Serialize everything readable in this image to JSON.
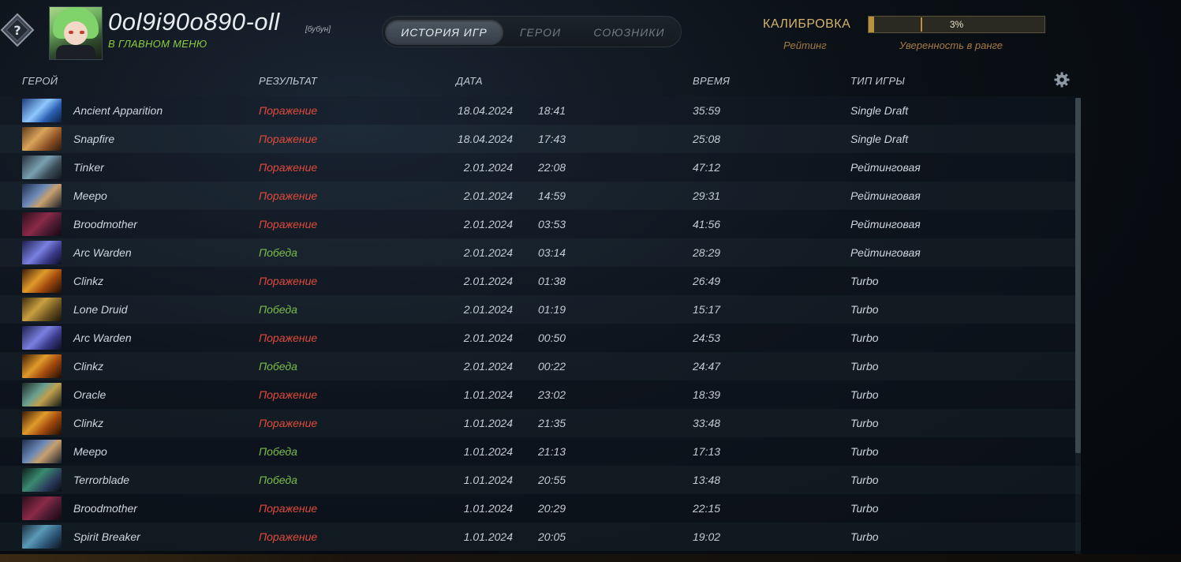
{
  "header": {
    "player_name": "0ol9i90o890-oll",
    "player_tag": "[бубун]",
    "status": "В ГЛАВНОМ МЕНЮ",
    "rank_badge_glyph": "?"
  },
  "tabs": [
    {
      "label": "ИСТОРИЯ ИГР",
      "active": true
    },
    {
      "label": "ГЕРОИ",
      "active": false
    },
    {
      "label": "СОЮЗНИКИ",
      "active": false
    }
  ],
  "calibration": {
    "title": "КАЛИБРОВКА",
    "rating_label": "Рейтинг",
    "confidence_value": "3%",
    "confidence_fraction": 0.03,
    "confidence_label": "Уверенность в ранге"
  },
  "columns": {
    "hero": "ГЕРОЙ",
    "result": "РЕЗУЛЬТАТ",
    "date": "ДАТА",
    "duration": "ВРЕМЯ",
    "mode": "ТИП ИГРЫ"
  },
  "icons": {
    "settings": "gear-icon"
  },
  "colors": {
    "loss": "#e04a3a",
    "win": "#7bbd4a",
    "status": "#8dcc3e",
    "gold": "#d3b36d"
  },
  "matches": [
    {
      "hero": "Ancient Apparition",
      "result": "Поражение",
      "win": false,
      "date": "18.04.2024",
      "time": "18:41",
      "duration": "35:59",
      "mode": "Single Draft",
      "icon": "ancient-apparition"
    },
    {
      "hero": "Snapfire",
      "result": "Поражение",
      "win": false,
      "date": "18.04.2024",
      "time": "17:43",
      "duration": "25:08",
      "mode": "Single Draft",
      "icon": "snapfire"
    },
    {
      "hero": "Tinker",
      "result": "Поражение",
      "win": false,
      "date": "2.01.2024",
      "time": "22:08",
      "duration": "47:12",
      "mode": "Рейтинговая",
      "icon": "tinker"
    },
    {
      "hero": "Meepo",
      "result": "Поражение",
      "win": false,
      "date": "2.01.2024",
      "time": "14:59",
      "duration": "29:31",
      "mode": "Рейтинговая",
      "icon": "meepo"
    },
    {
      "hero": "Broodmother",
      "result": "Поражение",
      "win": false,
      "date": "2.01.2024",
      "time": "03:53",
      "duration": "41:56",
      "mode": "Рейтинговая",
      "icon": "broodmother"
    },
    {
      "hero": "Arc Warden",
      "result": "Победа",
      "win": true,
      "date": "2.01.2024",
      "time": "03:14",
      "duration": "28:29",
      "mode": "Рейтинговая",
      "icon": "arc-warden"
    },
    {
      "hero": "Clinkz",
      "result": "Поражение",
      "win": false,
      "date": "2.01.2024",
      "time": "01:38",
      "duration": "26:49",
      "mode": "Turbo",
      "icon": "clinkz"
    },
    {
      "hero": "Lone Druid",
      "result": "Победа",
      "win": true,
      "date": "2.01.2024",
      "time": "01:19",
      "duration": "15:17",
      "mode": "Turbo",
      "icon": "lone-druid"
    },
    {
      "hero": "Arc Warden",
      "result": "Поражение",
      "win": false,
      "date": "2.01.2024",
      "time": "00:50",
      "duration": "24:53",
      "mode": "Turbo",
      "icon": "arc-warden"
    },
    {
      "hero": "Clinkz",
      "result": "Победа",
      "win": true,
      "date": "2.01.2024",
      "time": "00:22",
      "duration": "24:47",
      "mode": "Turbo",
      "icon": "clinkz"
    },
    {
      "hero": "Oracle",
      "result": "Поражение",
      "win": false,
      "date": "1.01.2024",
      "time": "23:02",
      "duration": "18:39",
      "mode": "Turbo",
      "icon": "oracle"
    },
    {
      "hero": "Clinkz",
      "result": "Поражение",
      "win": false,
      "date": "1.01.2024",
      "time": "21:35",
      "duration": "33:48",
      "mode": "Turbo",
      "icon": "clinkz"
    },
    {
      "hero": "Meepo",
      "result": "Победа",
      "win": true,
      "date": "1.01.2024",
      "time": "21:13",
      "duration": "17:13",
      "mode": "Turbo",
      "icon": "meepo"
    },
    {
      "hero": "Terrorblade",
      "result": "Победа",
      "win": true,
      "date": "1.01.2024",
      "time": "20:55",
      "duration": "13:48",
      "mode": "Turbo",
      "icon": "terrorblade"
    },
    {
      "hero": "Broodmother",
      "result": "Поражение",
      "win": false,
      "date": "1.01.2024",
      "time": "20:29",
      "duration": "22:15",
      "mode": "Turbo",
      "icon": "broodmother"
    },
    {
      "hero": "Spirit Breaker",
      "result": "Поражение",
      "win": false,
      "date": "1.01.2024",
      "time": "20:05",
      "duration": "19:02",
      "mode": "Turbo",
      "icon": "spirit-breaker"
    }
  ]
}
